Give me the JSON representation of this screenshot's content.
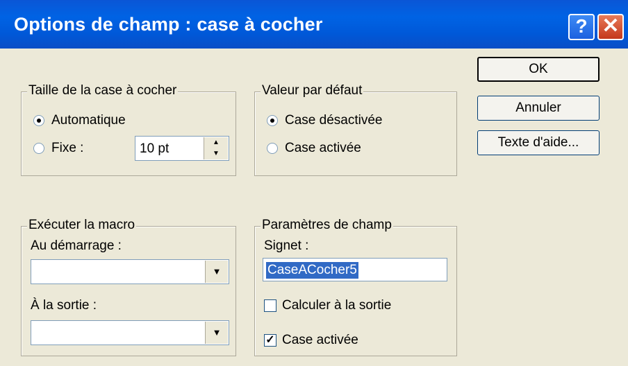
{
  "title": "Options de champ : case à cocher",
  "titlebar": {
    "help_label": "?",
    "close_label": "✕"
  },
  "buttons": {
    "ok": "OK",
    "cancel": "Annuler",
    "help_text": "Texte d'aide..."
  },
  "size_group": {
    "title": "Taille de la case à cocher",
    "auto_label": "Automatique",
    "fixed_label": "Fixe :",
    "fixed_value": "10 pt",
    "selected": "Automatique"
  },
  "default_group": {
    "title": "Valeur par défaut",
    "unchecked_label": "Case désactivée",
    "checked_label": "Case activée",
    "selected": "Case désactivée"
  },
  "macro_group": {
    "title": "Exécuter la macro",
    "entry_label": "Au démarrage :",
    "entry_value": "",
    "exit_label": "À la sortie :",
    "exit_value": ""
  },
  "field_group": {
    "title": "Paramètres de champ",
    "bookmark_label": "Signet :",
    "bookmark_value": "CaseACocher5",
    "calc_label": "Calculer à la sortie",
    "calc_checked": false,
    "enabled_label": "Case activée",
    "enabled_checked": true
  }
}
